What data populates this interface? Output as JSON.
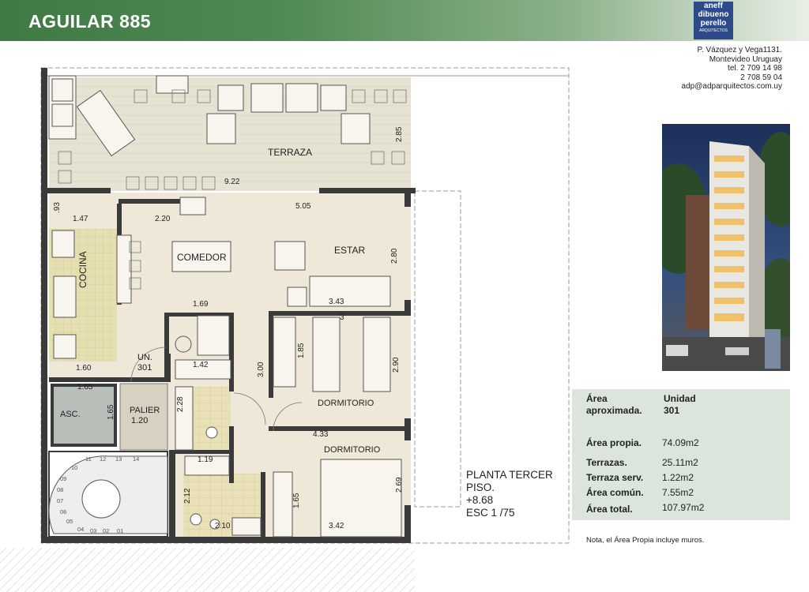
{
  "header": {
    "title": "AGUILAR 885"
  },
  "logo": {
    "line1": "aneff",
    "line2": "dibueno",
    "line3": "perello",
    "line4": "ARQUITECTOS"
  },
  "contact": {
    "address": "P. Vázquez y Vega1131.",
    "city": "Montevideo Uruguay",
    "tel1": "tel. 2 709 14 98",
    "tel2": "2 708 59 04",
    "email": "adp@adparquitectos.com.uy"
  },
  "plan": {
    "rooms": {
      "terraza": "TERRAZA",
      "comedor": "COMEDOR",
      "estar": "ESTAR",
      "cocina": "COCINA",
      "unidad": "UN.",
      "unidad_num": "301",
      "dormitorio1": "DORMITORIO",
      "dormitorio2": "DORMITORIO",
      "asc": "ASC.",
      "palier": "PALIER",
      "palier_dim": "1.20"
    },
    "dimensions": {
      "d922": "9.22",
      "d285": "2.85",
      "d220": "2.20",
      "d505": "5.05",
      "d093": ".93",
      "d147": "1.47",
      "d280": "2.80",
      "d169": "1.69",
      "d343": "3.43",
      "d185": "1.85",
      "d300": "3.00",
      "d290": "2.90",
      "d142": "1.42",
      "d160": "1.60",
      "d165a": "1.65",
      "d165b": "1.65",
      "d228": "2.28",
      "d433": "4.33",
      "d119": "1.19",
      "d212": "2.12",
      "d165c": "1.65",
      "d269": "2.69",
      "d210": "2.10",
      "d342": "3.42",
      "d3": "3"
    },
    "stairs": [
      "01",
      "02",
      "03",
      "04",
      "05",
      "06",
      "07",
      "08",
      "09",
      "10",
      "11",
      "12",
      "13",
      "14"
    ],
    "caption": {
      "line1": "PLANTA TERCER",
      "line2": "PISO.",
      "line3": "+8.68",
      "line4": "ESC 1 /75"
    }
  },
  "areas": {
    "heading_label_1": "Área",
    "heading_label_2": "aproximada.",
    "heading_value_1": "Unidad",
    "heading_value_2": "301",
    "rows": [
      {
        "label": "Área propia.",
        "value": "74.09m2"
      },
      {
        "label": "Terrazas.",
        "value": "25.11m2"
      },
      {
        "label": "Terraza serv.",
        "value": "1.22m2"
      },
      {
        "label": "Área común.",
        "value": "7.55m2"
      },
      {
        "label": "Área total.",
        "value": "107.97m2"
      }
    ]
  },
  "note": "Nota, el Área Propia incluye muros.",
  "colors": {
    "wall": "#3a3a3a",
    "floor": "#efe8d8",
    "terrace": "#e7e3d2",
    "tile": "#e6dfb2",
    "accent": "#3f7a45",
    "panel": "#dbe5dc"
  }
}
